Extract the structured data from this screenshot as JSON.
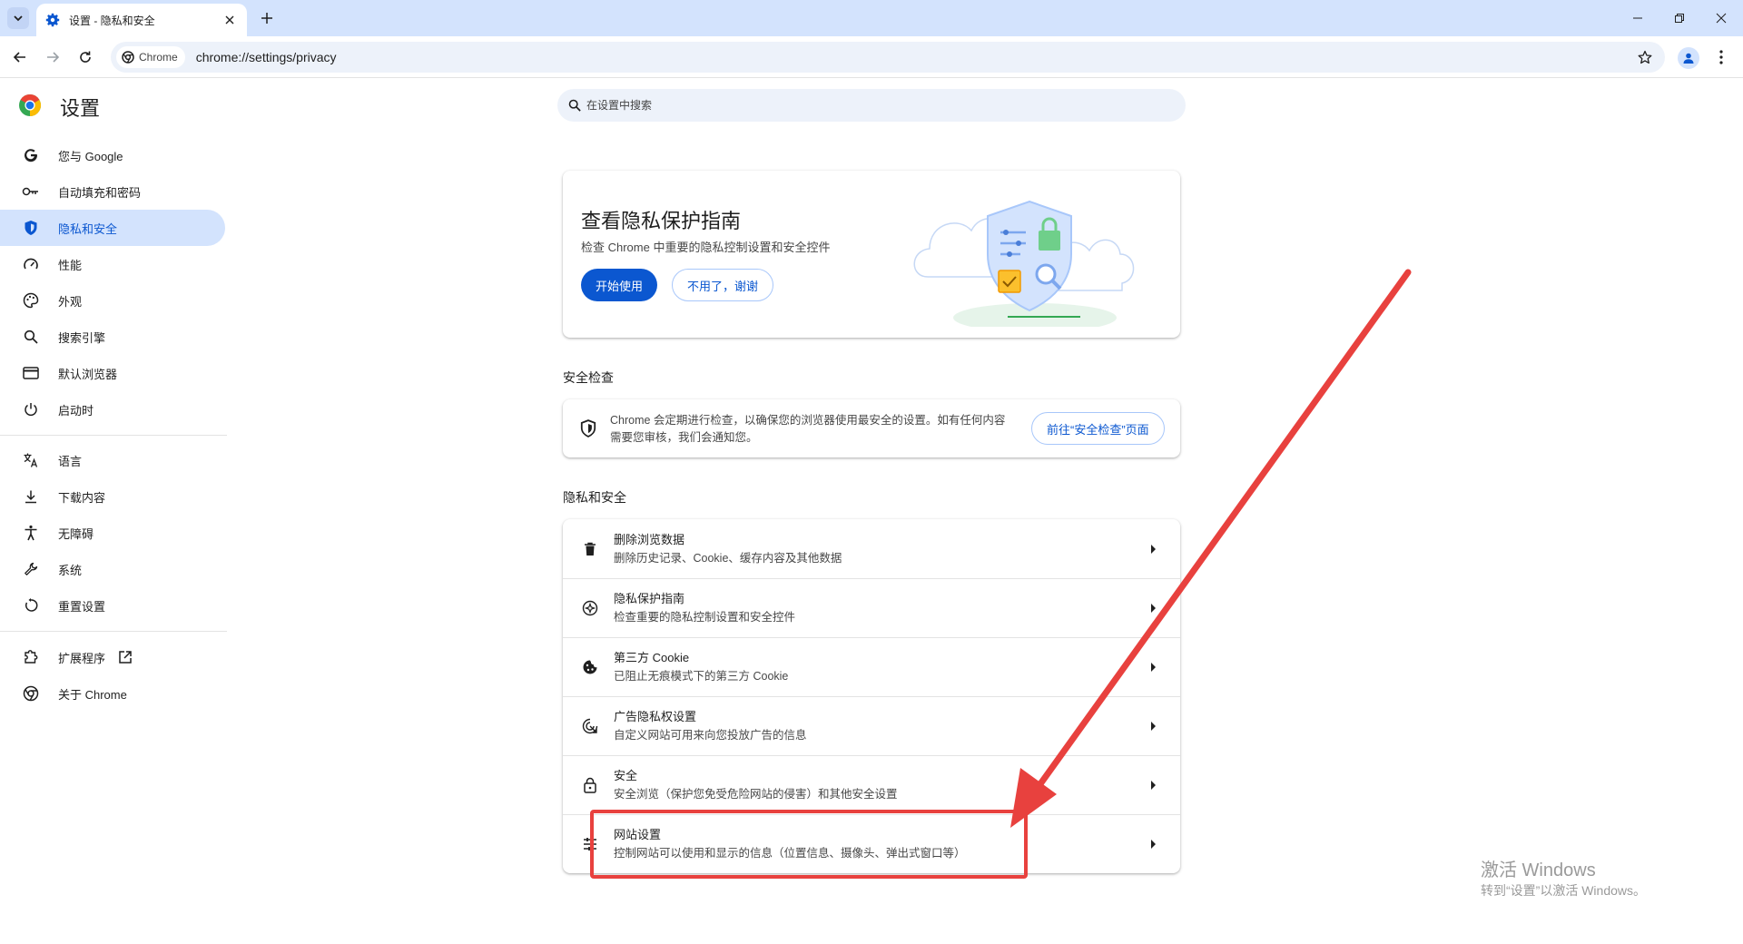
{
  "browser": {
    "tab_title": "设置 - 隐私和安全",
    "chip_label": "Chrome",
    "url": "chrome://settings/privacy"
  },
  "sidebar": {
    "title": "设置",
    "items": [
      {
        "label": "您与 Google",
        "icon": "google-g-icon"
      },
      {
        "label": "自动填充和密码",
        "icon": "key-icon"
      },
      {
        "label": "隐私和安全",
        "icon": "shield-icon",
        "active": true
      },
      {
        "label": "性能",
        "icon": "speedometer-icon"
      },
      {
        "label": "外观",
        "icon": "palette-icon"
      },
      {
        "label": "搜索引擎",
        "icon": "search-icon"
      },
      {
        "label": "默认浏览器",
        "icon": "browser-window-icon"
      },
      {
        "label": "启动时",
        "icon": "power-icon"
      },
      {
        "label": "语言",
        "icon": "translate-icon"
      },
      {
        "label": "下载内容",
        "icon": "download-icon"
      },
      {
        "label": "无障碍",
        "icon": "accessibility-icon"
      },
      {
        "label": "系统",
        "icon": "wrench-icon"
      },
      {
        "label": "重置设置",
        "icon": "reset-icon"
      },
      {
        "label": "扩展程序",
        "icon": "extension-icon"
      },
      {
        "label": "关于 Chrome",
        "icon": "chrome-icon"
      }
    ]
  },
  "search": {
    "placeholder": "在设置中搜索"
  },
  "guide": {
    "title": "查看隐私保护指南",
    "subtitle": "检查 Chrome 中重要的隐私控制设置和安全控件",
    "start_label": "开始使用",
    "dismiss_label": "不用了，谢谢"
  },
  "safety_check": {
    "section_title": "安全检查",
    "text": "Chrome 会定期进行检查，以确保您的浏览器使用最安全的设置。如有任何内容需要您审核，我们会通知您。",
    "button_label": "前往“安全检查”页面"
  },
  "privacy": {
    "section_title": "隐私和安全",
    "rows": [
      {
        "title": "删除浏览数据",
        "subtitle": "删除历史记录、Cookie、缓存内容及其他数据",
        "icon": "trash-icon"
      },
      {
        "title": "隐私保护指南",
        "subtitle": "检查重要的隐私控制设置和安全控件",
        "icon": "compass-icon"
      },
      {
        "title": "第三方 Cookie",
        "subtitle": "已阻止无痕模式下的第三方 Cookie",
        "icon": "cookie-icon"
      },
      {
        "title": "广告隐私权设置",
        "subtitle": "自定义网站可用来向您投放广告的信息",
        "icon": "ad-privacy-icon"
      },
      {
        "title": "安全",
        "subtitle": "安全浏览（保护您免受危险网站的侵害）和其他安全设置",
        "icon": "lock-icon"
      },
      {
        "title": "网站设置",
        "subtitle": "控制网站可以使用和显示的信息（位置信息、摄像头、弹出式窗口等）",
        "icon": "tune-icon"
      }
    ]
  },
  "watermark": {
    "title": "激活 Windows",
    "subtitle": "转到“设置”以激活 Windows。"
  },
  "colors": {
    "accent": "#0b57d0",
    "annotation": "#e8413e",
    "active_nav": "#d3e3fd"
  }
}
